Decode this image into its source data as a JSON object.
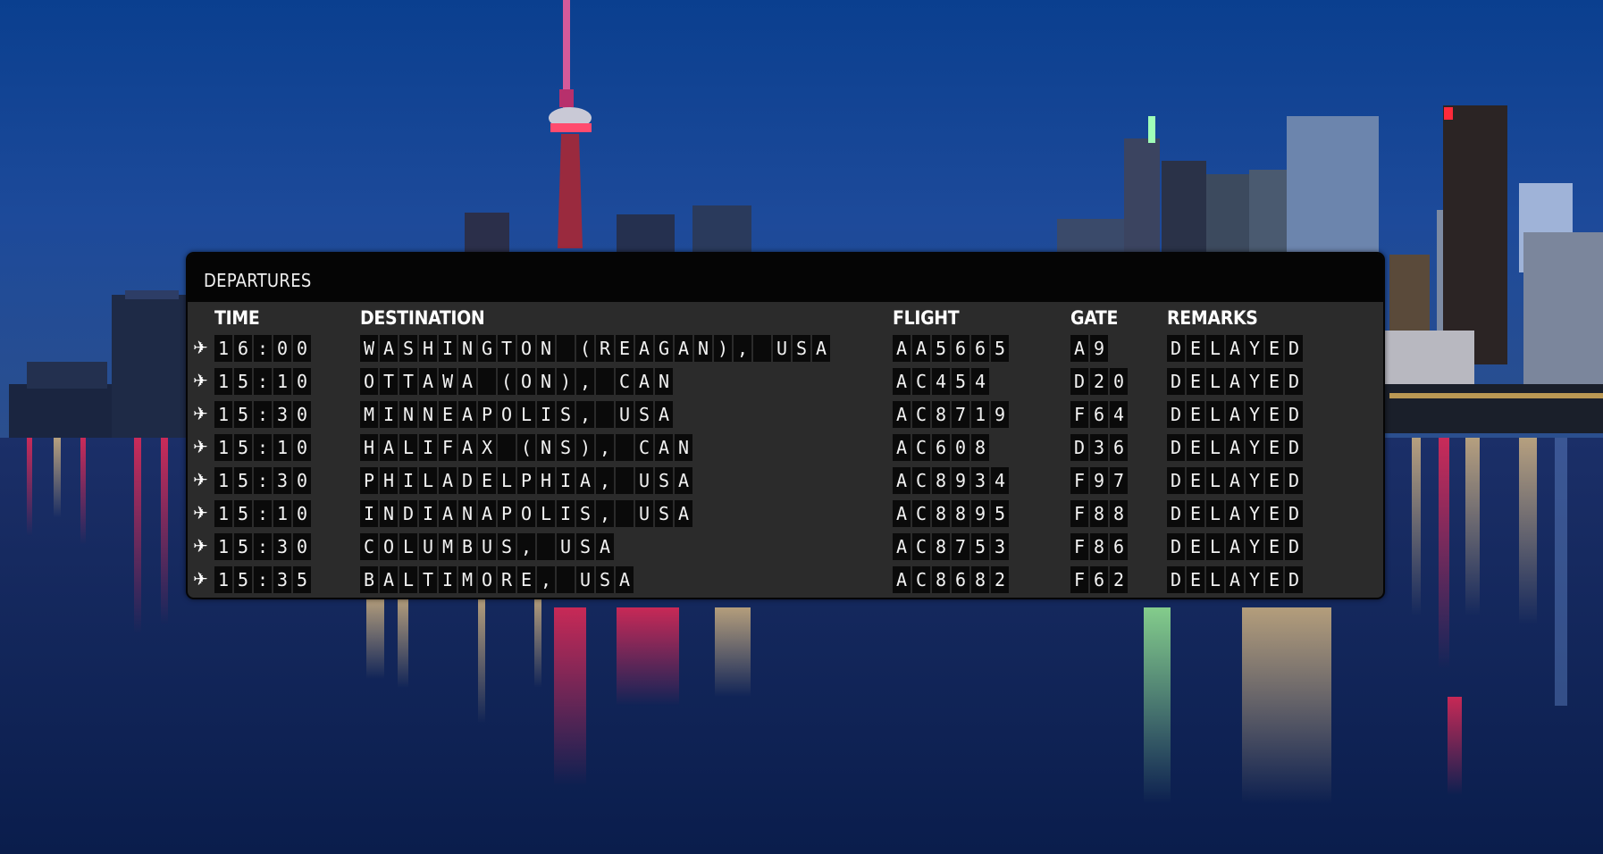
{
  "board": {
    "title": "DEPARTURES",
    "columns": {
      "time": "TIME",
      "destination": "DESTINATION",
      "flight": "FLIGHT",
      "gate": "GATE",
      "remarks": "REMARKS"
    },
    "plane_icon": "airplane-icon",
    "rows": [
      {
        "time": "16:00",
        "destination": "WASHINGTON (REAGAN), USA",
        "flight": "AA5665",
        "gate": "A9",
        "remarks": "DELAYED"
      },
      {
        "time": "15:10",
        "destination": "OTTAWA (ON), CAN",
        "flight": "AC454",
        "gate": "D20",
        "remarks": "DELAYED"
      },
      {
        "time": "15:30",
        "destination": "MINNEAPOLIS, USA",
        "flight": "AC8719",
        "gate": "F64",
        "remarks": "DELAYED"
      },
      {
        "time": "15:10",
        "destination": "HALIFAX (NS), CAN",
        "flight": "AC608",
        "gate": "D36",
        "remarks": "DELAYED"
      },
      {
        "time": "15:30",
        "destination": "PHILADELPHIA, USA",
        "flight": "AC8934",
        "gate": "F97",
        "remarks": "DELAYED"
      },
      {
        "time": "15:10",
        "destination": "INDIANAPOLIS, USA",
        "flight": "AC8895",
        "gate": "F88",
        "remarks": "DELAYED"
      },
      {
        "time": "15:30",
        "destination": "COLUMBUS, USA",
        "flight": "AC8753",
        "gate": "F86",
        "remarks": "DELAYED"
      },
      {
        "time": "15:35",
        "destination": "BALTIMORE, USA",
        "flight": "AC8682",
        "gate": "F62",
        "remarks": "DELAYED"
      }
    ]
  },
  "colors": {
    "board_bg": "#2b2b2b",
    "header_bg": "#050505",
    "cell_bg": "#0a0a0a",
    "text": "#f2f2f2",
    "sky_top": "#0b3a8a",
    "water": "#0a1f4a"
  }
}
